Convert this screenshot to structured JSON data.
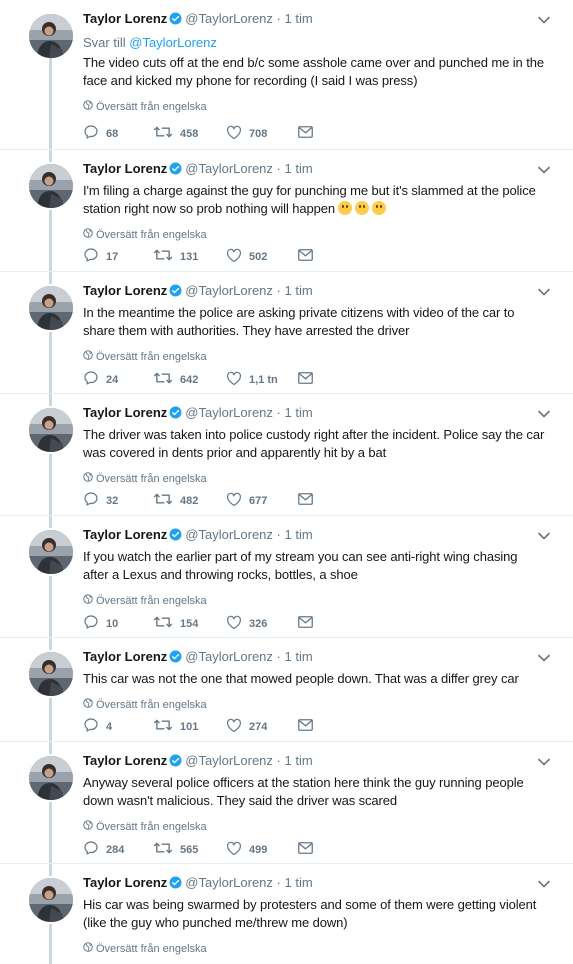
{
  "author": {
    "name": "Taylor Lorenz",
    "handle": "@TaylorLorenz",
    "time": "1 tim"
  },
  "separator": "·",
  "translate_label": "Översätt från engelska",
  "tweets": [
    {
      "reply_prefix": "Svar till",
      "reply_to": "@TaylorLorenz",
      "text": "The video cuts off at the end b/c some asshole came over and punched me in the face and kicked my phone for recording (I said I was press)",
      "replies": "68",
      "retweets": "458",
      "likes": "708"
    },
    {
      "text": "I'm filing a charge against the guy for punching me but it's slammed at the police station right now so prob nothing will happen",
      "emoji": "upside-down-face-emoji",
      "replies": "17",
      "retweets": "131",
      "likes": "502"
    },
    {
      "text": "In the meantime the police are asking private citizens with video of the car to share them with authorities. They have arrested the driver",
      "replies": "24",
      "retweets": "642",
      "likes": "1,1 tn"
    },
    {
      "text": "The driver was taken into police custody right after the incident. Police say the car was covered in dents prior and apparently hit by a bat",
      "replies": "32",
      "retweets": "482",
      "likes": "677"
    },
    {
      "text": "If you watch the earlier part of my stream you can see anti-right wing chasing after a Lexus and throwing rocks, bottles, a shoe",
      "replies": "10",
      "retweets": "154",
      "likes": "326"
    },
    {
      "text": "This car was not the one that mowed people down. That was a differ grey car",
      "replies": "4",
      "retweets": "101",
      "likes": "274"
    },
    {
      "text": "Anyway several police officers at the station here think the guy running people down wasn't malicious. They said the driver was scared",
      "replies": "284",
      "retweets": "565",
      "likes": "499"
    },
    {
      "text": "His car was being swarmed by protesters and some of them were getting violent (like the guy who punched me/threw me down)",
      "replies": "",
      "retweets": "",
      "likes": ""
    }
  ],
  "colors": {
    "link": "#1da1f2",
    "muted": "#657786",
    "line": "#ccd6dd",
    "emoji": "#ffcc4d"
  }
}
